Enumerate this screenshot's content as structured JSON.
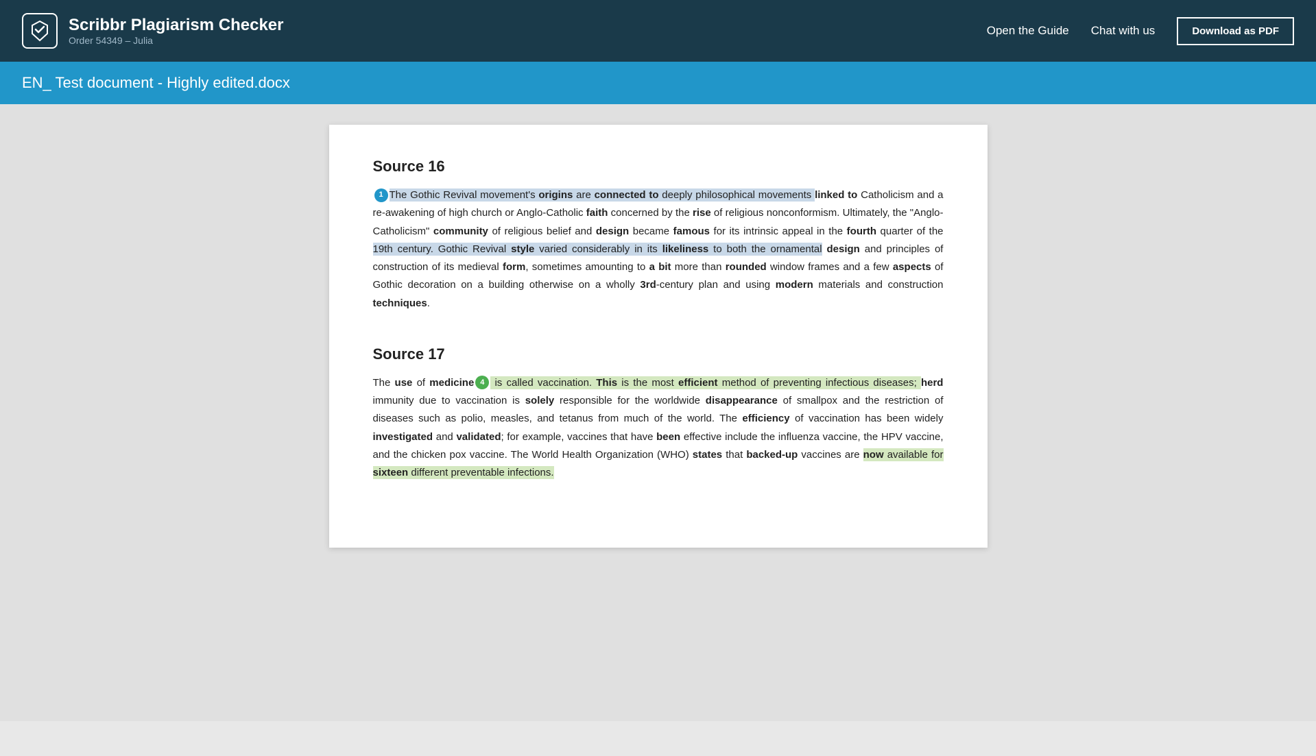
{
  "header": {
    "logo_title": "Scribbr Plagiarism Checker",
    "logo_subtitle": "Order 54349 – Julia",
    "nav_guide": "Open the Guide",
    "nav_chat": "Chat with us",
    "download_btn": "Download as PDF"
  },
  "doc_title_bar": {
    "title": "EN_ Test document - Highly edited.docx"
  },
  "sources": [
    {
      "id": "source16",
      "title": "Source 16",
      "badge_number": "1",
      "badge_color": "badge-blue",
      "paragraphs": [
        {
          "id": "source16-para",
          "segments": [
            {
              "text": "The Gothic Revival movement's ",
              "style": "highlight-blue"
            },
            {
              "text": "origins",
              "style": "highlight-blue bold"
            },
            {
              "text": " are ",
              "style": "highlight-blue"
            },
            {
              "text": "connected to",
              "style": "highlight-blue bold"
            },
            {
              "text": " deeply philosophical movements ",
              "style": "highlight-blue"
            },
            {
              "text": "linked to",
              "style": "bold"
            },
            {
              "text": " Catholicism and a re-awakening of high church or Anglo-Catholic ",
              "style": ""
            },
            {
              "text": "faith",
              "style": "bold"
            },
            {
              "text": " concerned by the ",
              "style": ""
            },
            {
              "text": "rise",
              "style": "bold"
            },
            {
              "text": " of religious nonconformism. Ultimately, the \"Anglo-Catholicism\" ",
              "style": ""
            },
            {
              "text": "community",
              "style": "bold"
            },
            {
              "text": " of religious belief and ",
              "style": ""
            },
            {
              "text": "design",
              "style": "bold"
            },
            {
              "text": " became ",
              "style": ""
            },
            {
              "text": "famous",
              "style": "bold"
            },
            {
              "text": " for its intrinsic appeal in the ",
              "style": ""
            },
            {
              "text": "fourth",
              "style": "bold"
            },
            {
              "text": " quarter of the 19th century. Gothic Revival ",
              "style": "highlight-blue"
            },
            {
              "text": "style",
              "style": "highlight-blue bold"
            },
            {
              "text": " varied considerably in its ",
              "style": "highlight-blue"
            },
            {
              "text": "likeliness",
              "style": "highlight-blue bold"
            },
            {
              "text": " to both the ornamental ",
              "style": "highlight-blue"
            },
            {
              "text": "design",
              "style": "bold"
            },
            {
              "text": " and principles of construction of its medieval ",
              "style": ""
            },
            {
              "text": "form",
              "style": "bold"
            },
            {
              "text": ", sometimes amounting to ",
              "style": ""
            },
            {
              "text": "a bit",
              "style": "bold"
            },
            {
              "text": " more than ",
              "style": ""
            },
            {
              "text": "rounded",
              "style": "bold"
            },
            {
              "text": " window frames and a few ",
              "style": ""
            },
            {
              "text": "aspects",
              "style": "bold"
            },
            {
              "text": " of Gothic decoration on a building otherwise on a wholly ",
              "style": ""
            },
            {
              "text": "3rd",
              "style": "bold"
            },
            {
              "text": "-century plan and using ",
              "style": ""
            },
            {
              "text": "modern",
              "style": "bold"
            },
            {
              "text": " materials and construction ",
              "style": ""
            },
            {
              "text": "techniques",
              "style": "bold"
            },
            {
              "text": ".",
              "style": ""
            }
          ]
        }
      ]
    },
    {
      "id": "source17",
      "title": "Source 17",
      "badge_number": "4",
      "badge_color": "badge-green",
      "paragraphs": [
        {
          "id": "source17-para",
          "segments": [
            {
              "text": "The ",
              "style": ""
            },
            {
              "text": "use",
              "style": "bold"
            },
            {
              "text": " of ",
              "style": ""
            },
            {
              "text": "medicine",
              "style": "bold"
            },
            {
              "text": " is called vaccination. ",
              "style": "highlight-yellow"
            },
            {
              "text": "This",
              "style": "highlight-yellow bold"
            },
            {
              "text": " is the most ",
              "style": "highlight-yellow"
            },
            {
              "text": "efficient",
              "style": "highlight-yellow bold"
            },
            {
              "text": " method of preventing infectious diseases; ",
              "style": "highlight-yellow"
            },
            {
              "text": "herd",
              "style": "bold"
            },
            {
              "text": " immunity due to vaccination is ",
              "style": ""
            },
            {
              "text": "solely",
              "style": "bold"
            },
            {
              "text": " responsible for the worldwide ",
              "style": ""
            },
            {
              "text": "disappearance",
              "style": "bold"
            },
            {
              "text": " of smallpox and the restriction of diseases such as polio, measles, and tetanus from much of the world. The ",
              "style": ""
            },
            {
              "text": "efficiency",
              "style": "bold"
            },
            {
              "text": " of vaccination has been widely ",
              "style": ""
            },
            {
              "text": "investigated",
              "style": "bold"
            },
            {
              "text": " and ",
              "style": ""
            },
            {
              "text": "validated",
              "style": "bold"
            },
            {
              "text": "; for example, vaccines that have ",
              "style": ""
            },
            {
              "text": "been",
              "style": "bold"
            },
            {
              "text": " effective include the influenza vaccine, the HPV vaccine, and the chicken pox vaccine. The World Health Organization (WHO) ",
              "style": ""
            },
            {
              "text": "states",
              "style": "bold"
            },
            {
              "text": " that ",
              "style": ""
            },
            {
              "text": "backed-up",
              "style": "bold"
            },
            {
              "text": " vaccines are ",
              "style": "highlight-yellow"
            },
            {
              "text": "now",
              "style": "highlight-yellow bold"
            },
            {
              "text": " available for ",
              "style": "highlight-yellow"
            },
            {
              "text": "sixteen",
              "style": "highlight-yellow bold"
            },
            {
              "text": " different preventable infections.",
              "style": "highlight-yellow"
            }
          ]
        }
      ]
    }
  ],
  "icons": {
    "logo": "🎓"
  }
}
